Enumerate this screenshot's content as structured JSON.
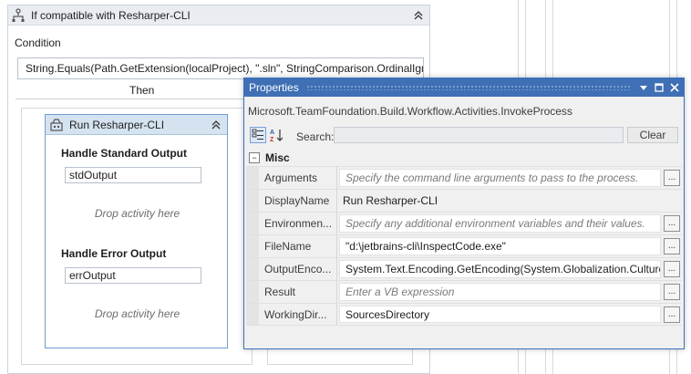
{
  "designer": {
    "if_activity": {
      "title": "If compatible with Resharper-CLI",
      "condition_label": "Condition",
      "condition_value": "String.Equals(Path.GetExtension(localProject), \".sln\", StringComparison.OrdinalIgno",
      "then_label": "Then"
    },
    "invoke_activity": {
      "title": "Run Resharper-CLI",
      "std_output_label": "Handle Standard Output",
      "std_output_value": "stdOutput",
      "std_drop_hint": "Drop activity here",
      "err_output_label": "Handle Error Output",
      "err_output_value": "errOutput",
      "err_drop_hint": "Drop activity here"
    }
  },
  "properties": {
    "title": "Properties",
    "type_name": "Microsoft.TeamFoundation.Build.Workflow.Activities.InvokeProcess",
    "search_label": "Search:",
    "search_value": "",
    "clear_label": "Clear",
    "category": "Misc",
    "rows": [
      {
        "name": "Arguments",
        "value": "Specify the command line arguments to pass to the process.",
        "hint": true,
        "button": "..."
      },
      {
        "name": "DisplayName",
        "value": "Run Resharper-CLI",
        "hint": false,
        "button": ""
      },
      {
        "name": "Environmen...",
        "value": "Specify any additional environment variables and their values.",
        "hint": true,
        "button": "..."
      },
      {
        "name": "FileName",
        "value": "\"d:\\jetbrains-cli\\InspectCode.exe\"",
        "hint": false,
        "button": "..."
      },
      {
        "name": "OutputEnco...",
        "value": "System.Text.Encoding.GetEncoding(System.Globalization.CultureI",
        "hint": false,
        "button": "..."
      },
      {
        "name": "Result",
        "value": "Enter a VB expression",
        "hint": true,
        "button": "..."
      },
      {
        "name": "WorkingDir...",
        "value": "SourcesDirectory",
        "hint": false,
        "button": "..."
      }
    ]
  },
  "colors": {
    "titlebar": "#3f6fb5",
    "activity_border": "#6e9ecb",
    "hint_text": "#7a7a7a"
  },
  "icons": [
    "if-activity-icon",
    "collapse-icon",
    "invoke-process-icon",
    "categorized-icon",
    "alphabetical-icon",
    "dropdown-icon",
    "pin-icon",
    "maximize-icon",
    "close-icon"
  ]
}
